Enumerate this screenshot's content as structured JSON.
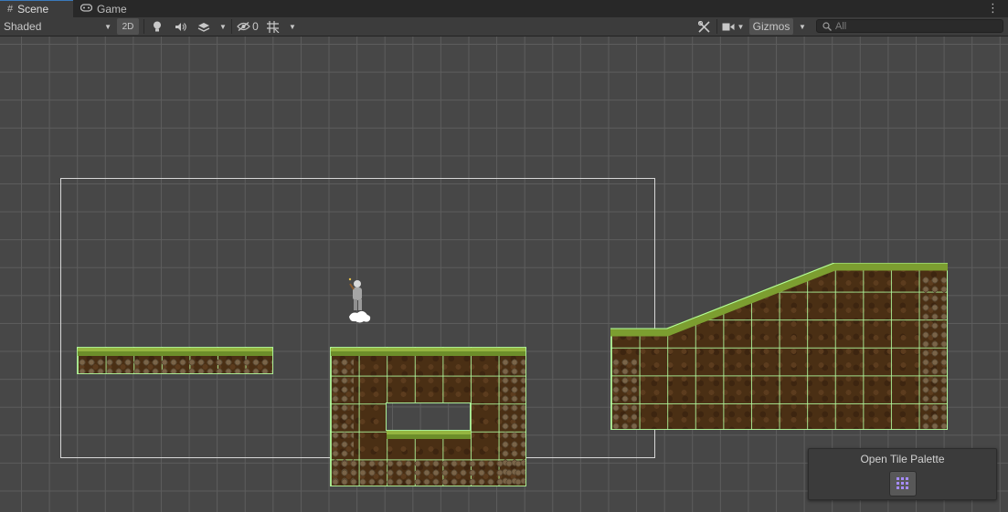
{
  "tabs": [
    {
      "label": "Scene",
      "icon": "hash-icon",
      "active": true
    },
    {
      "label": "Game",
      "icon": "gamepad-icon",
      "active": false
    }
  ],
  "toolbar": {
    "shading_mode": "Shaded",
    "mode_2d": "2D",
    "hidden_count": "0",
    "gizmos_label": "Gizmos",
    "search_placeholder": "All"
  },
  "overlay": {
    "tile_palette_label": "Open Tile Palette"
  },
  "colors": {
    "tile_outline": "#b4ffa0",
    "camera_frame": "#d7d7d7",
    "scene_bg": "#474747",
    "grid_line": "#5d5d5d"
  }
}
